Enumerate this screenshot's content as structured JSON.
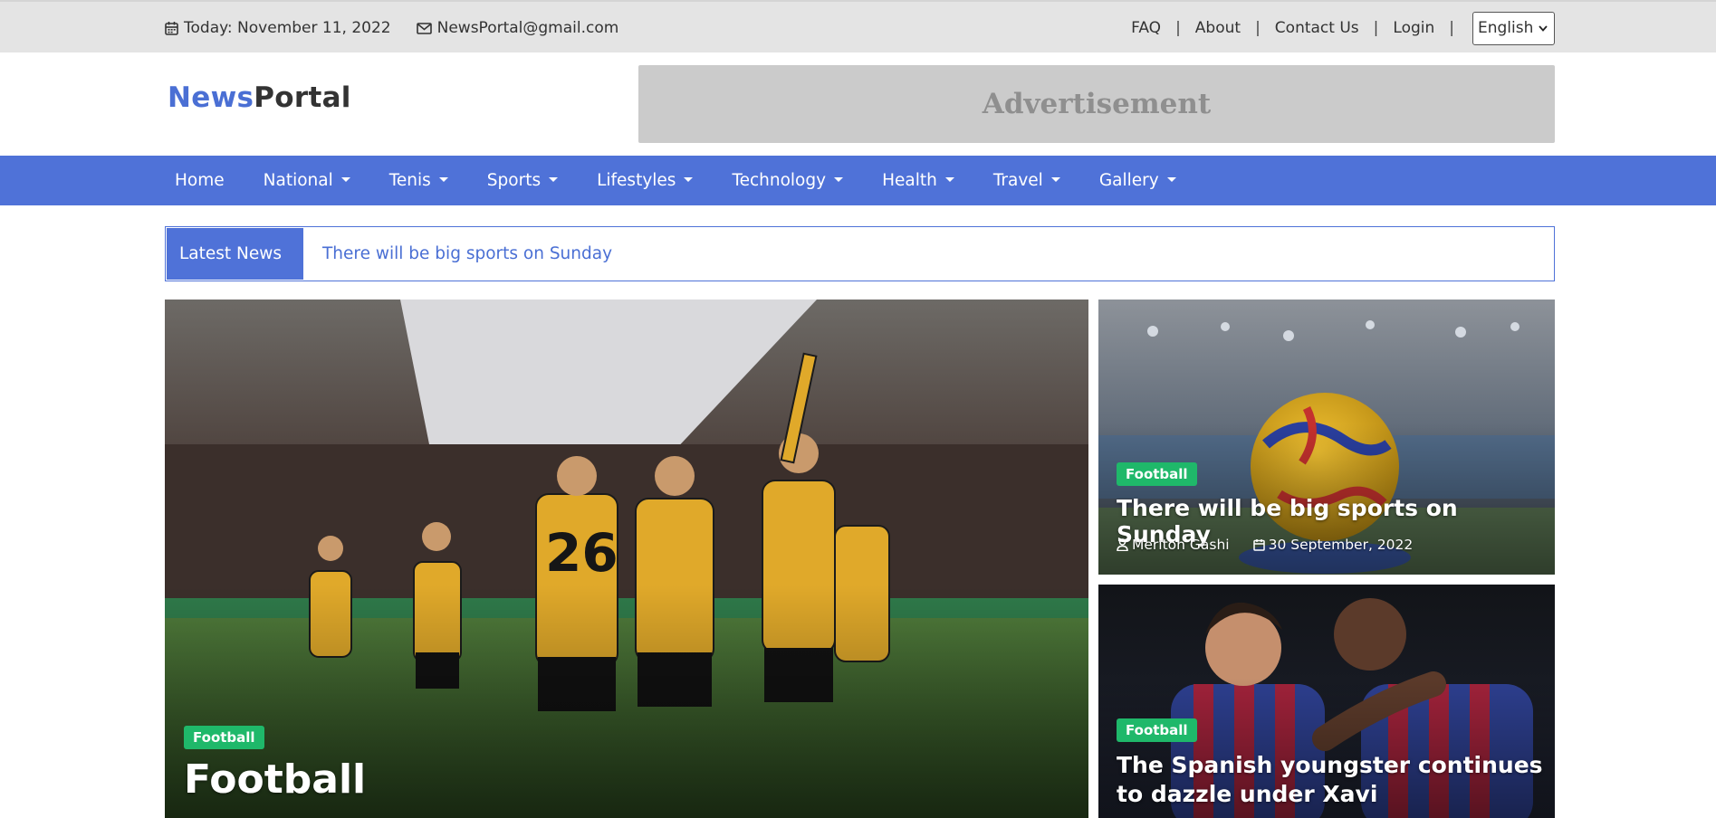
{
  "topbar": {
    "date_text": "Today: November 11, 2022",
    "email_text": "NewsPortal@gmail.com",
    "links": [
      "FAQ",
      "About",
      "Contact Us",
      "Login"
    ],
    "separator": "|",
    "language": "English",
    "icons": [
      "calendar-icon",
      "envelope-icon",
      "chevron-down-icon"
    ]
  },
  "header": {
    "logo_part1": "News",
    "logo_part2": "Portal",
    "ad_text": "Advertisement"
  },
  "nav": {
    "items": [
      {
        "label": "Home",
        "dropdown": false
      },
      {
        "label": "National",
        "dropdown": true
      },
      {
        "label": "Tenis",
        "dropdown": true
      },
      {
        "label": "Sports",
        "dropdown": true
      },
      {
        "label": "Lifestyles",
        "dropdown": true
      },
      {
        "label": "Technology",
        "dropdown": true
      },
      {
        "label": "Health",
        "dropdown": true
      },
      {
        "label": "Travel",
        "dropdown": true
      },
      {
        "label": "Gallery",
        "dropdown": true
      }
    ]
  },
  "ticker": {
    "label": "Latest News",
    "headline": "There will be big sports on Sunday"
  },
  "featured": {
    "category": "Football",
    "title": "Football"
  },
  "side_cards": [
    {
      "category": "Football",
      "title": "There will be big sports on Sunday",
      "author": "Meriton Gashi",
      "date": "30 September, 2022"
    },
    {
      "category": "Football",
      "title_line1": "The Spanish youngster continues",
      "title_line2": "to dazzle under Xavi"
    }
  ],
  "colors": {
    "brand_blue": "#4f72d8",
    "badge_green": "#1fb86a",
    "topbar_bg": "#e4e4e4",
    "ad_bg": "#cbcbcb"
  }
}
